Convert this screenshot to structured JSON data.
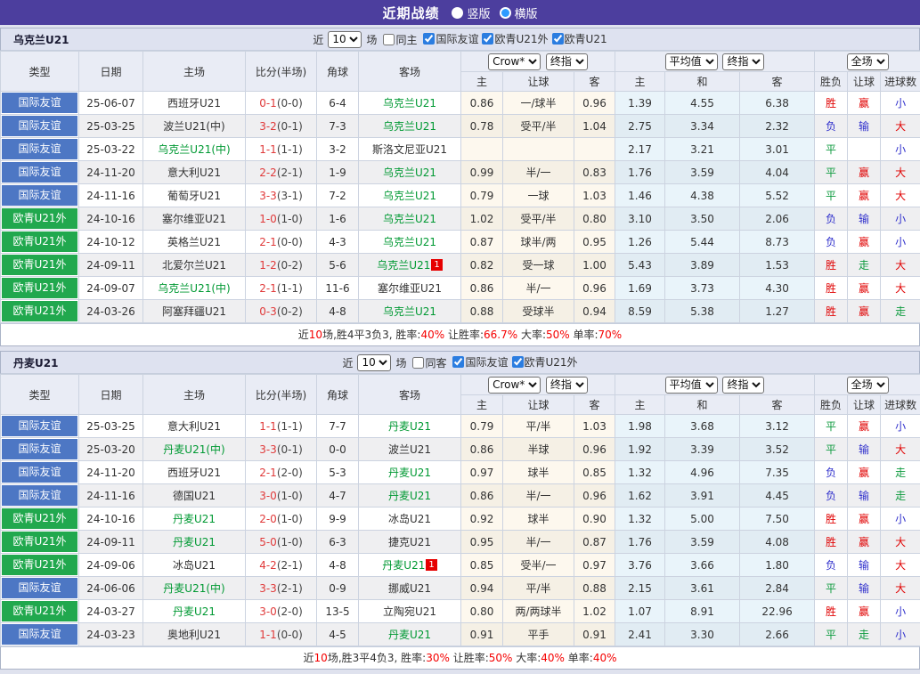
{
  "title_bar": {
    "title": "近期战绩",
    "vertical_label": "竖版",
    "horizontal_label": "横版"
  },
  "table": {
    "main_headers": [
      "类型",
      "日期",
      "主场",
      "比分(半场)",
      "角球",
      "客场"
    ],
    "sub_headers": [
      "主",
      "让球",
      "客",
      "主",
      "和",
      "客",
      "胜负",
      "让球",
      "进球数"
    ],
    "selects": {
      "bookmaker": "Crow*",
      "final_odds": "终指",
      "average": "平均值",
      "final_odds2": "终指",
      "full_match": "全场"
    }
  },
  "colors": {
    "title_bar_bg": "#4c3e9e",
    "league": {
      "国际友谊": "#4d77c4",
      "欧青U21外": "#21a84e",
      "欧青U21": "#21a84e"
    },
    "team_text_green": "#009933",
    "score_red": "#e03a3a",
    "card_red": "#e60000",
    "result_red": "#e00000",
    "result_blue": "#3030cc",
    "result_green": "#0f9b3f",
    "result_text": {
      "胜": "r",
      "负": "b",
      "平": "g",
      "赢": "r",
      "输": "b",
      "走": "g",
      "大": "r",
      "小": "b"
    },
    "crow_bg": "#fdf8ee",
    "avg_bg": "#e9f4fa"
  },
  "sections": [
    {
      "team": "乌克兰U21",
      "filter": {
        "near": "近",
        "count": "10",
        "games": "场",
        "same": "同主",
        "leagues": [
          "国际友谊",
          "欧青U21外",
          "欧青U21"
        ]
      },
      "rows": [
        {
          "league": "国际友谊",
          "date": "25-06-07",
          "home": "西班牙U21",
          "score": "0-1",
          "half": "(0-0)",
          "corners": "6-4",
          "away": "乌克兰U21",
          "odds": [
            "0.86",
            "一/球半",
            "0.96"
          ],
          "avg": [
            "1.39",
            "4.55",
            "6.38"
          ],
          "results": [
            "胜",
            "赢",
            "小"
          ]
        },
        {
          "league": "国际友谊",
          "date": "25-03-25",
          "home": "波兰U21(中)",
          "score": "3-2",
          "half": "(0-1)",
          "corners": "7-3",
          "away": "乌克兰U21",
          "odds": [
            "0.78",
            "受平/半",
            "1.04"
          ],
          "avg": [
            "2.75",
            "3.34",
            "2.32"
          ],
          "results": [
            "负",
            "输",
            "大"
          ]
        },
        {
          "league": "国际友谊",
          "date": "25-03-22",
          "home": "乌克兰U21(中)",
          "score": "1-1",
          "half": "(1-1)",
          "corners": "3-2",
          "away": "斯洛文尼亚U21",
          "odds": [
            "",
            "",
            ""
          ],
          "avg": [
            "2.17",
            "3.21",
            "3.01"
          ],
          "results": [
            "平",
            "",
            "小"
          ]
        },
        {
          "league": "国际友谊",
          "date": "24-11-20",
          "home": "意大利U21",
          "score": "2-2",
          "half": "(2-1)",
          "corners": "1-9",
          "away": "乌克兰U21",
          "odds": [
            "0.99",
            "半/一",
            "0.83"
          ],
          "avg": [
            "1.76",
            "3.59",
            "4.04"
          ],
          "results": [
            "平",
            "赢",
            "大"
          ]
        },
        {
          "league": "国际友谊",
          "date": "24-11-16",
          "home": "葡萄牙U21",
          "score": "3-3",
          "half": "(3-1)",
          "corners": "7-2",
          "away": "乌克兰U21",
          "odds": [
            "0.79",
            "一球",
            "1.03"
          ],
          "avg": [
            "1.46",
            "4.38",
            "5.52"
          ],
          "results": [
            "平",
            "赢",
            "大"
          ]
        },
        {
          "league": "欧青U21外",
          "date": "24-10-16",
          "home": "塞尔维亚U21",
          "score": "1-0",
          "half": "(1-0)",
          "corners": "1-6",
          "away": "乌克兰U21",
          "odds": [
            "1.02",
            "受平/半",
            "0.80"
          ],
          "avg": [
            "3.10",
            "3.50",
            "2.06"
          ],
          "results": [
            "负",
            "输",
            "小"
          ]
        },
        {
          "league": "欧青U21外",
          "date": "24-10-12",
          "home": "英格兰U21",
          "score": "2-1",
          "half": "(0-0)",
          "corners": "4-3",
          "away": "乌克兰U21",
          "odds": [
            "0.87",
            "球半/两",
            "0.95"
          ],
          "avg": [
            "1.26",
            "5.44",
            "8.73"
          ],
          "results": [
            "负",
            "赢",
            "小"
          ]
        },
        {
          "league": "欧青U21外",
          "date": "24-09-11",
          "home": "北爱尔兰U21",
          "score": "1-2",
          "half": "(0-2)",
          "corners": "5-6",
          "away": "乌克兰U21",
          "away_card": "1",
          "odds": [
            "0.82",
            "受一球",
            "1.00"
          ],
          "avg": [
            "5.43",
            "3.89",
            "1.53"
          ],
          "results": [
            "胜",
            "走",
            "大"
          ]
        },
        {
          "league": "欧青U21外",
          "date": "24-09-07",
          "home": "乌克兰U21(中)",
          "score": "2-1",
          "half": "(1-1)",
          "corners": "11-6",
          "away": "塞尔维亚U21",
          "odds": [
            "0.86",
            "半/一",
            "0.96"
          ],
          "avg": [
            "1.69",
            "3.73",
            "4.30"
          ],
          "results": [
            "胜",
            "赢",
            "大"
          ]
        },
        {
          "league": "欧青U21外",
          "date": "24-03-26",
          "home": "阿塞拜疆U21",
          "score": "0-3",
          "half": "(0-2)",
          "corners": "4-8",
          "away": "乌克兰U21",
          "odds": [
            "0.88",
            "受球半",
            "0.94"
          ],
          "avg": [
            "8.59",
            "5.38",
            "1.27"
          ],
          "results": [
            "胜",
            "赢",
            "走"
          ]
        }
      ],
      "summary": [
        {
          "t": "近"
        },
        {
          "t": "10",
          "red": true
        },
        {
          "t": "场,胜4平3负3, 胜率:"
        },
        {
          "t": "40%",
          "red": true
        },
        {
          "t": " 让胜率:"
        },
        {
          "t": "66.7%",
          "red": true
        },
        {
          "t": " 大率:"
        },
        {
          "t": "50%",
          "red": true
        },
        {
          "t": " 单率:"
        },
        {
          "t": "70%",
          "red": true
        }
      ]
    },
    {
      "team": "丹麦U21",
      "filter": {
        "near": "近",
        "count": "10",
        "games": "场",
        "same": "同客",
        "leagues": [
          "国际友谊",
          "欧青U21外"
        ]
      },
      "rows": [
        {
          "league": "国际友谊",
          "date": "25-03-25",
          "home": "意大利U21",
          "score": "1-1",
          "half": "(1-1)",
          "corners": "7-7",
          "away": "丹麦U21",
          "odds": [
            "0.79",
            "平/半",
            "1.03"
          ],
          "avg": [
            "1.98",
            "3.68",
            "3.12"
          ],
          "results": [
            "平",
            "赢",
            "小"
          ]
        },
        {
          "league": "国际友谊",
          "date": "25-03-20",
          "home": "丹麦U21(中)",
          "score": "3-3",
          "half": "(0-1)",
          "corners": "0-0",
          "away": "波兰U21",
          "odds": [
            "0.86",
            "半球",
            "0.96"
          ],
          "avg": [
            "1.92",
            "3.39",
            "3.52"
          ],
          "results": [
            "平",
            "输",
            "大"
          ]
        },
        {
          "league": "国际友谊",
          "date": "24-11-20",
          "home": "西班牙U21",
          "score": "2-1",
          "half": "(2-0)",
          "corners": "5-3",
          "away": "丹麦U21",
          "odds": [
            "0.97",
            "球半",
            "0.85"
          ],
          "avg": [
            "1.32",
            "4.96",
            "7.35"
          ],
          "results": [
            "负",
            "赢",
            "走"
          ]
        },
        {
          "league": "国际友谊",
          "date": "24-11-16",
          "home": "德国U21",
          "score": "3-0",
          "half": "(1-0)",
          "corners": "4-7",
          "away": "丹麦U21",
          "odds": [
            "0.86",
            "半/一",
            "0.96"
          ],
          "avg": [
            "1.62",
            "3.91",
            "4.45"
          ],
          "results": [
            "负",
            "输",
            "走"
          ]
        },
        {
          "league": "欧青U21外",
          "date": "24-10-16",
          "home": "丹麦U21",
          "score": "2-0",
          "half": "(1-0)",
          "corners": "9-9",
          "away": "冰岛U21",
          "odds": [
            "0.92",
            "球半",
            "0.90"
          ],
          "avg": [
            "1.32",
            "5.00",
            "7.50"
          ],
          "results": [
            "胜",
            "赢",
            "小"
          ]
        },
        {
          "league": "欧青U21外",
          "date": "24-09-11",
          "home": "丹麦U21",
          "score": "5-0",
          "half": "(1-0)",
          "corners": "6-3",
          "away": "捷克U21",
          "odds": [
            "0.95",
            "半/一",
            "0.87"
          ],
          "avg": [
            "1.76",
            "3.59",
            "4.08"
          ],
          "results": [
            "胜",
            "赢",
            "大"
          ]
        },
        {
          "league": "欧青U21外",
          "date": "24-09-06",
          "home": "冰岛U21",
          "score": "4-2",
          "half": "(2-1)",
          "corners": "4-8",
          "away": "丹麦U21",
          "away_card": "1",
          "odds": [
            "0.85",
            "受半/一",
            "0.97"
          ],
          "avg": [
            "3.76",
            "3.66",
            "1.80"
          ],
          "results": [
            "负",
            "输",
            "大"
          ]
        },
        {
          "league": "国际友谊",
          "date": "24-06-06",
          "home": "丹麦U21(中)",
          "score": "3-3",
          "half": "(2-1)",
          "corners": "0-9",
          "away": "挪威U21",
          "odds": [
            "0.94",
            "平/半",
            "0.88"
          ],
          "avg": [
            "2.15",
            "3.61",
            "2.84"
          ],
          "results": [
            "平",
            "输",
            "大"
          ]
        },
        {
          "league": "欧青U21外",
          "date": "24-03-27",
          "home": "丹麦U21",
          "score": "3-0",
          "half": "(2-0)",
          "corners": "13-5",
          "away": "立陶宛U21",
          "odds": [
            "0.80",
            "两/两球半",
            "1.02"
          ],
          "avg": [
            "1.07",
            "8.91",
            "22.96"
          ],
          "results": [
            "胜",
            "赢",
            "小"
          ]
        },
        {
          "league": "国际友谊",
          "date": "24-03-23",
          "home": "奥地利U21",
          "score": "1-1",
          "half": "(0-0)",
          "corners": "4-5",
          "away": "丹麦U21",
          "odds": [
            "0.91",
            "平手",
            "0.91"
          ],
          "avg": [
            "2.41",
            "3.30",
            "2.66"
          ],
          "results": [
            "平",
            "走",
            "小"
          ]
        }
      ],
      "summary": [
        {
          "t": "近"
        },
        {
          "t": "10",
          "red": true
        },
        {
          "t": "场,胜3平4负3, 胜率:"
        },
        {
          "t": "30%",
          "red": true
        },
        {
          "t": " 让胜率:"
        },
        {
          "t": "50%",
          "red": true
        },
        {
          "t": " 大率:"
        },
        {
          "t": "40%",
          "red": true
        },
        {
          "t": " 单率:"
        },
        {
          "t": "40%",
          "red": true
        }
      ]
    }
  ]
}
